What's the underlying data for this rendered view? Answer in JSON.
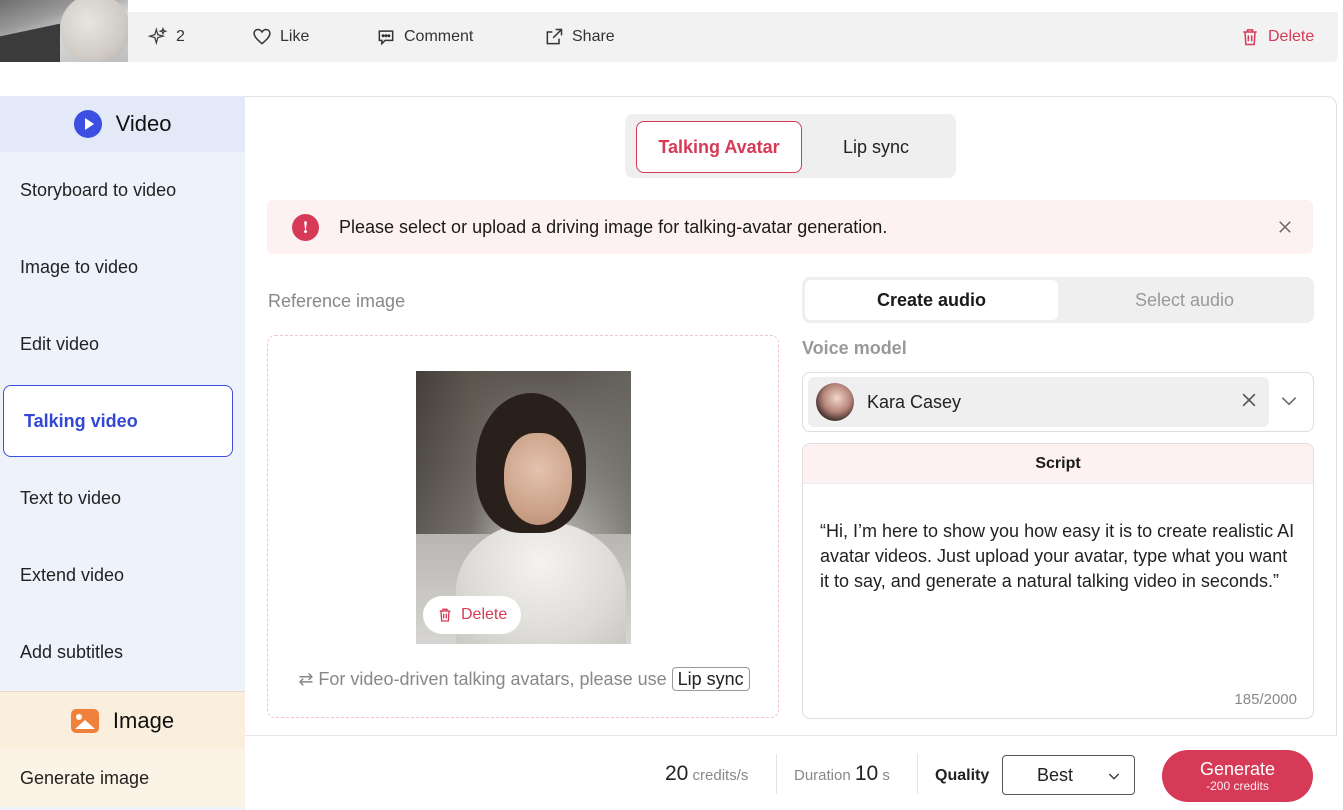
{
  "actionbar": {
    "sparkle_count": "2",
    "like_label": "Like",
    "comment_label": "Comment",
    "share_label": "Share",
    "delete_label": "Delete"
  },
  "sidebar": {
    "video_header": "Video",
    "items": [
      {
        "label": "Storyboard to video"
      },
      {
        "label": "Image to video"
      },
      {
        "label": "Edit video"
      },
      {
        "label": "Talking video",
        "active": true
      },
      {
        "label": "Text to video"
      },
      {
        "label": "Extend video"
      },
      {
        "label": "Add subtitles"
      }
    ],
    "image_header": "Image",
    "image_items": [
      {
        "label": "Generate image"
      }
    ]
  },
  "mode_tabs": {
    "active": "Talking Avatar",
    "other": "Lip sync"
  },
  "alert": {
    "icon": "!",
    "text": "Please select or upload a driving image for talking-avatar generation."
  },
  "reference": {
    "label": "Reference image",
    "delete_label": "Delete",
    "hint_prefix": "For video-driven talking avatars, please use",
    "hint_chip": "Lip sync"
  },
  "audio_tabs": {
    "active": "Create audio",
    "other": "Select audio"
  },
  "voice": {
    "label": "Voice model",
    "name": "Kara Casey"
  },
  "script": {
    "header": "Script",
    "text": "“Hi, I’m here to show you how easy it is to create realistic AI avatar videos. Just upload your avatar, type what you want it to say, and generate a natural talking video in seconds.”",
    "count": "185/2000"
  },
  "footer": {
    "credits_value": "20",
    "credits_unit": "credits/s",
    "duration_label": "Duration",
    "duration_value": "10",
    "duration_unit": "s",
    "quality_label": "Quality",
    "quality_value": "Best",
    "generate_label": "Generate",
    "generate_cost": "-200 credits"
  },
  "colors": {
    "accent": "#d63a56",
    "sidebar_active": "#3b4fe0",
    "sidebar_bg": "#eef2fb",
    "image_section_bg": "#f9efdc"
  }
}
